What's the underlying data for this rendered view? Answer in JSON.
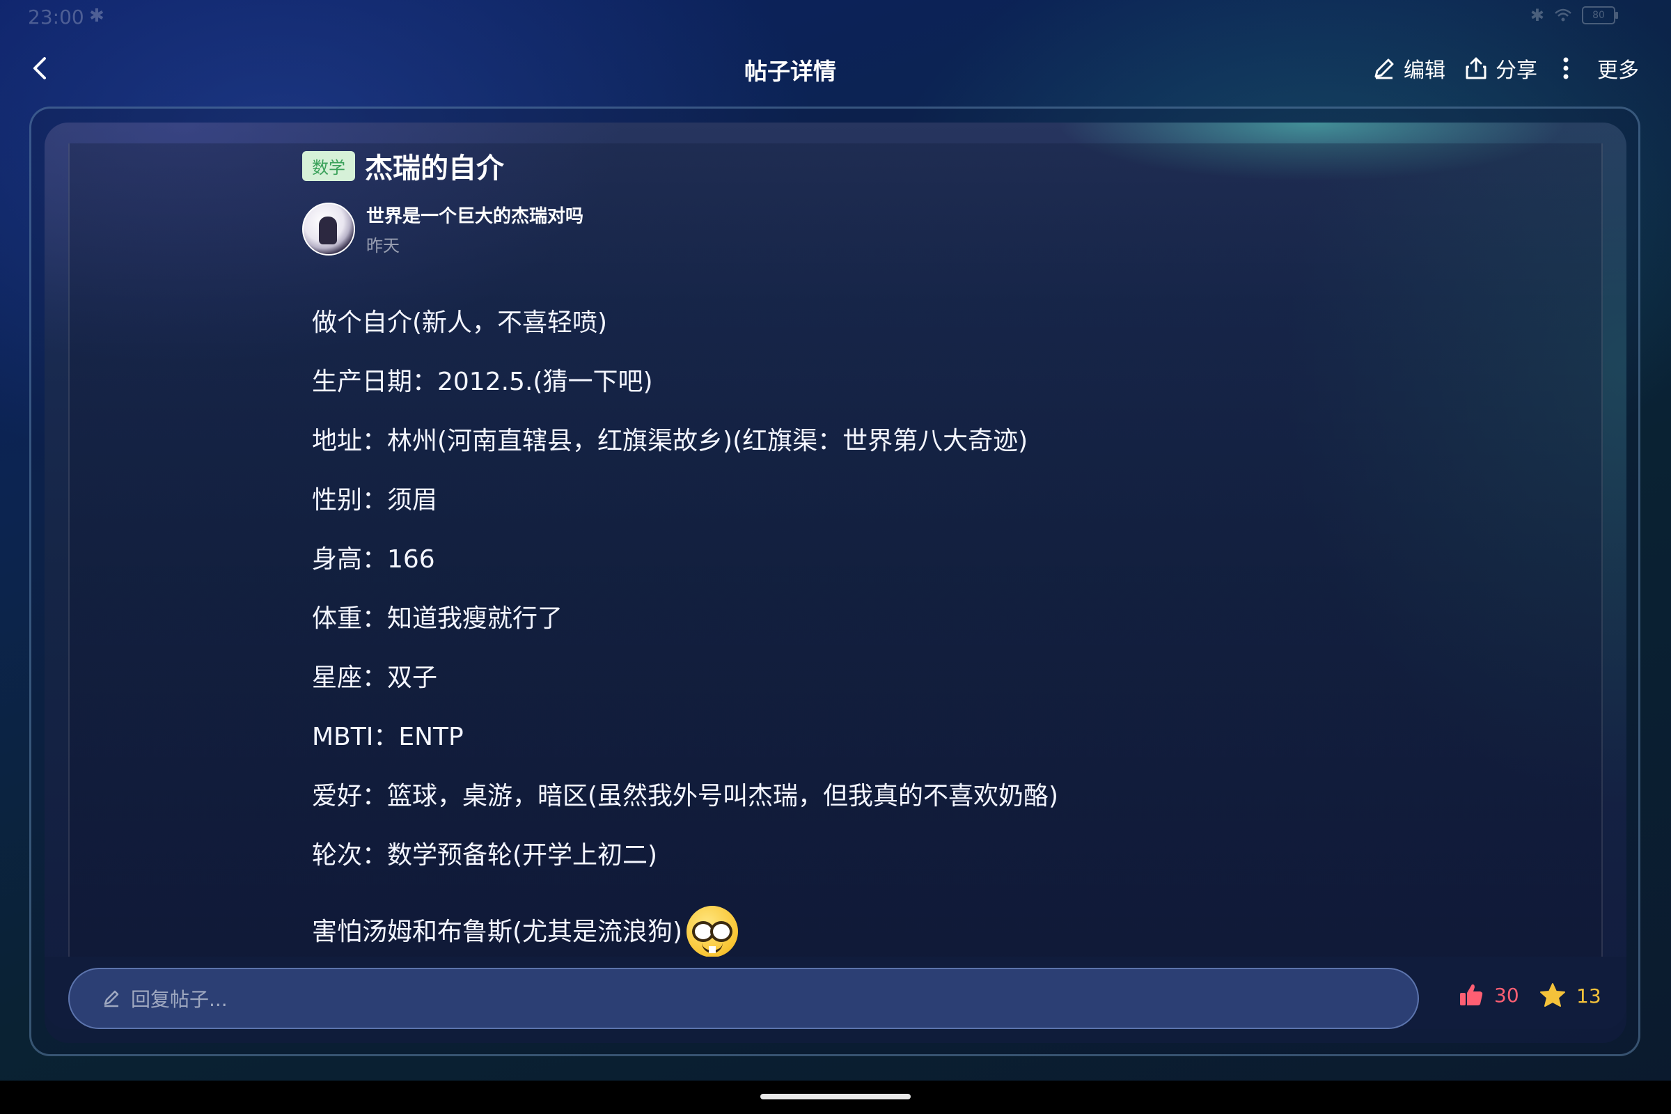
{
  "status_bar": {
    "time": "23:00",
    "battery": "80",
    "icons": [
      "bluetooth-icon",
      "bluetooth-icon",
      "wifi-icon",
      "battery-icon"
    ]
  },
  "header": {
    "title": "帖子详情",
    "actions": {
      "edit": "编辑",
      "share": "分享",
      "more": "更多"
    }
  },
  "post": {
    "category": "数学",
    "title": "杰瑞的自介",
    "author": "世界是一个巨大的杰瑞对吗",
    "time": "昨天",
    "lines": [
      "做个自介(新人，不喜轻喷)",
      "生产日期：2012.5.(猜一下吧)",
      "地址：林州(河南直辖县，红旗渠故乡)(红旗渠：世界第八大奇迹)",
      "性别：须眉",
      "身高：166",
      "体重：知道我瘦就行了",
      "星座：双子",
      "MBTI：ENTP",
      "爱好：篮球，桌游，暗区(虽然我外号叫杰瑞，但我真的不喜欢奶酪)",
      "轮次：数学预备轮(开学上初二)",
      "害怕汤姆和布鲁斯(尤其是流浪狗)"
    ],
    "last_line_emoji": "nerd-face-emoji"
  },
  "bottom_bar": {
    "reply_placeholder": "回复帖子...",
    "likes": "30",
    "favorites": "13"
  },
  "colors": {
    "tag_bg": "#d6f1d8",
    "tag_text": "#3aa15a",
    "like": "#ff5f73",
    "favorite": "#f5c23a"
  }
}
